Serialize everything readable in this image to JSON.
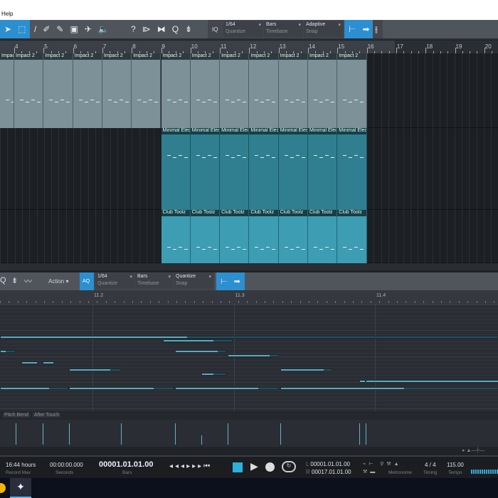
{
  "menu": {
    "help": "Help"
  },
  "toolbar": {
    "quantize": {
      "value": "1/64",
      "label": "Quantize"
    },
    "timebase": {
      "value": "Bars",
      "label": "Timebase"
    },
    "snap": {
      "value": "Adaptive",
      "label": "Snap"
    },
    "iq": "IQ",
    "help_icon": "?",
    "q_icon": "Q"
  },
  "ruler": {
    "bars": [
      "4",
      "5",
      "6",
      "7",
      "8",
      "9",
      "10",
      "11",
      "12",
      "13",
      "14",
      "15",
      "16",
      "17",
      "18",
      "19",
      "20"
    ]
  },
  "tracks": [
    {
      "clip_name": "Impact 2",
      "color": "#7c9198"
    },
    {
      "clip_name": "Minimal Elec",
      "color": "#2f7f90"
    },
    {
      "clip_name": "Club Toolz",
      "color": "#3c9db3"
    }
  ],
  "editor": {
    "action": "Action",
    "aq": "AQ",
    "quantize": {
      "value": "1/64",
      "label": "Quantize"
    },
    "timebase": {
      "value": "Bars",
      "label": "Timebase"
    },
    "snap": {
      "value": "Quantize",
      "label": "Snap"
    },
    "ruler": [
      "11.2",
      "11.3",
      "11.4"
    ],
    "ctrl_tabs": [
      "Pitch Bend",
      "After Touch"
    ]
  },
  "notes": [
    {
      "start": 0.345,
      "end": 3.87,
      "fill_end": 1.665,
      "row": 8
    },
    {
      "start": 1.5,
      "end": 1.99,
      "fill_end": 1.85,
      "row": 9
    },
    {
      "start": 0.345,
      "end": 0.456,
      "fill_end": 0.38,
      "row": 12
    },
    {
      "start": 0.496,
      "end": 0.617,
      "fill_end": 0.6,
      "row": 15
    },
    {
      "start": 0.647,
      "end": 0.733,
      "fill_end": 0.72,
      "row": 15
    },
    {
      "start": 0.834,
      "end": 1.2,
      "fill_end": 1.12,
      "row": 17
    },
    {
      "start": 1.584,
      "end": 1.947,
      "fill_end": 1.88,
      "row": 12
    },
    {
      "start": 1.957,
      "end": 2.32,
      "fill_end": 2.25,
      "row": 13
    },
    {
      "start": 1.77,
      "end": 1.947,
      "fill_end": 1.85,
      "row": 18
    },
    {
      "start": 2.33,
      "end": 2.7,
      "fill_end": 2.63,
      "row": 17
    },
    {
      "start": 2.89,
      "end": 2.93,
      "fill_end": 2.925,
      "row": 20
    },
    {
      "start": 2.935,
      "end": 3.87,
      "fill_end": 3.87,
      "row": 20
    },
    {
      "start": 0.345,
      "end": 0.83,
      "fill_end": 0.69,
      "row": 22
    },
    {
      "start": 0.834,
      "end": 1.58,
      "fill_end": 1.43,
      "row": 22
    },
    {
      "start": 1.584,
      "end": 2.32,
      "fill_end": 2.17,
      "row": 22
    },
    {
      "start": 2.33,
      "end": 3.87,
      "fill_end": 3.2,
      "row": 22
    }
  ],
  "velocities": [
    {
      "pos": 0.456,
      "value": 1
    },
    {
      "pos": 0.647,
      "value": 1
    },
    {
      "pos": 0.834,
      "value": 1
    },
    {
      "pos": 1.2,
      "value": 1
    },
    {
      "pos": 1.584,
      "value": 1
    },
    {
      "pos": 1.77,
      "value": 0.45
    },
    {
      "pos": 1.957,
      "value": 1
    },
    {
      "pos": 2.33,
      "value": 1
    },
    {
      "pos": 2.89,
      "value": 1
    },
    {
      "pos": 2.935,
      "value": 1
    }
  ],
  "transport": {
    "record_max": {
      "value": "16:44 hours",
      "label": "Record Max"
    },
    "seconds": {
      "value": "00:00:00.000",
      "label": "Seconds"
    },
    "bars": {
      "value": "00001.01.01.00",
      "label": "Bars"
    },
    "left": {
      "prefix": "L",
      "value": "00001.01.01.00"
    },
    "right": {
      "prefix": "R",
      "value": "00017.01.01.00"
    },
    "metronome": "Metronome",
    "timing": {
      "value": "4 / 4",
      "label": "Timing"
    },
    "tempo": {
      "value": "115.00",
      "label": "Tempo"
    }
  }
}
